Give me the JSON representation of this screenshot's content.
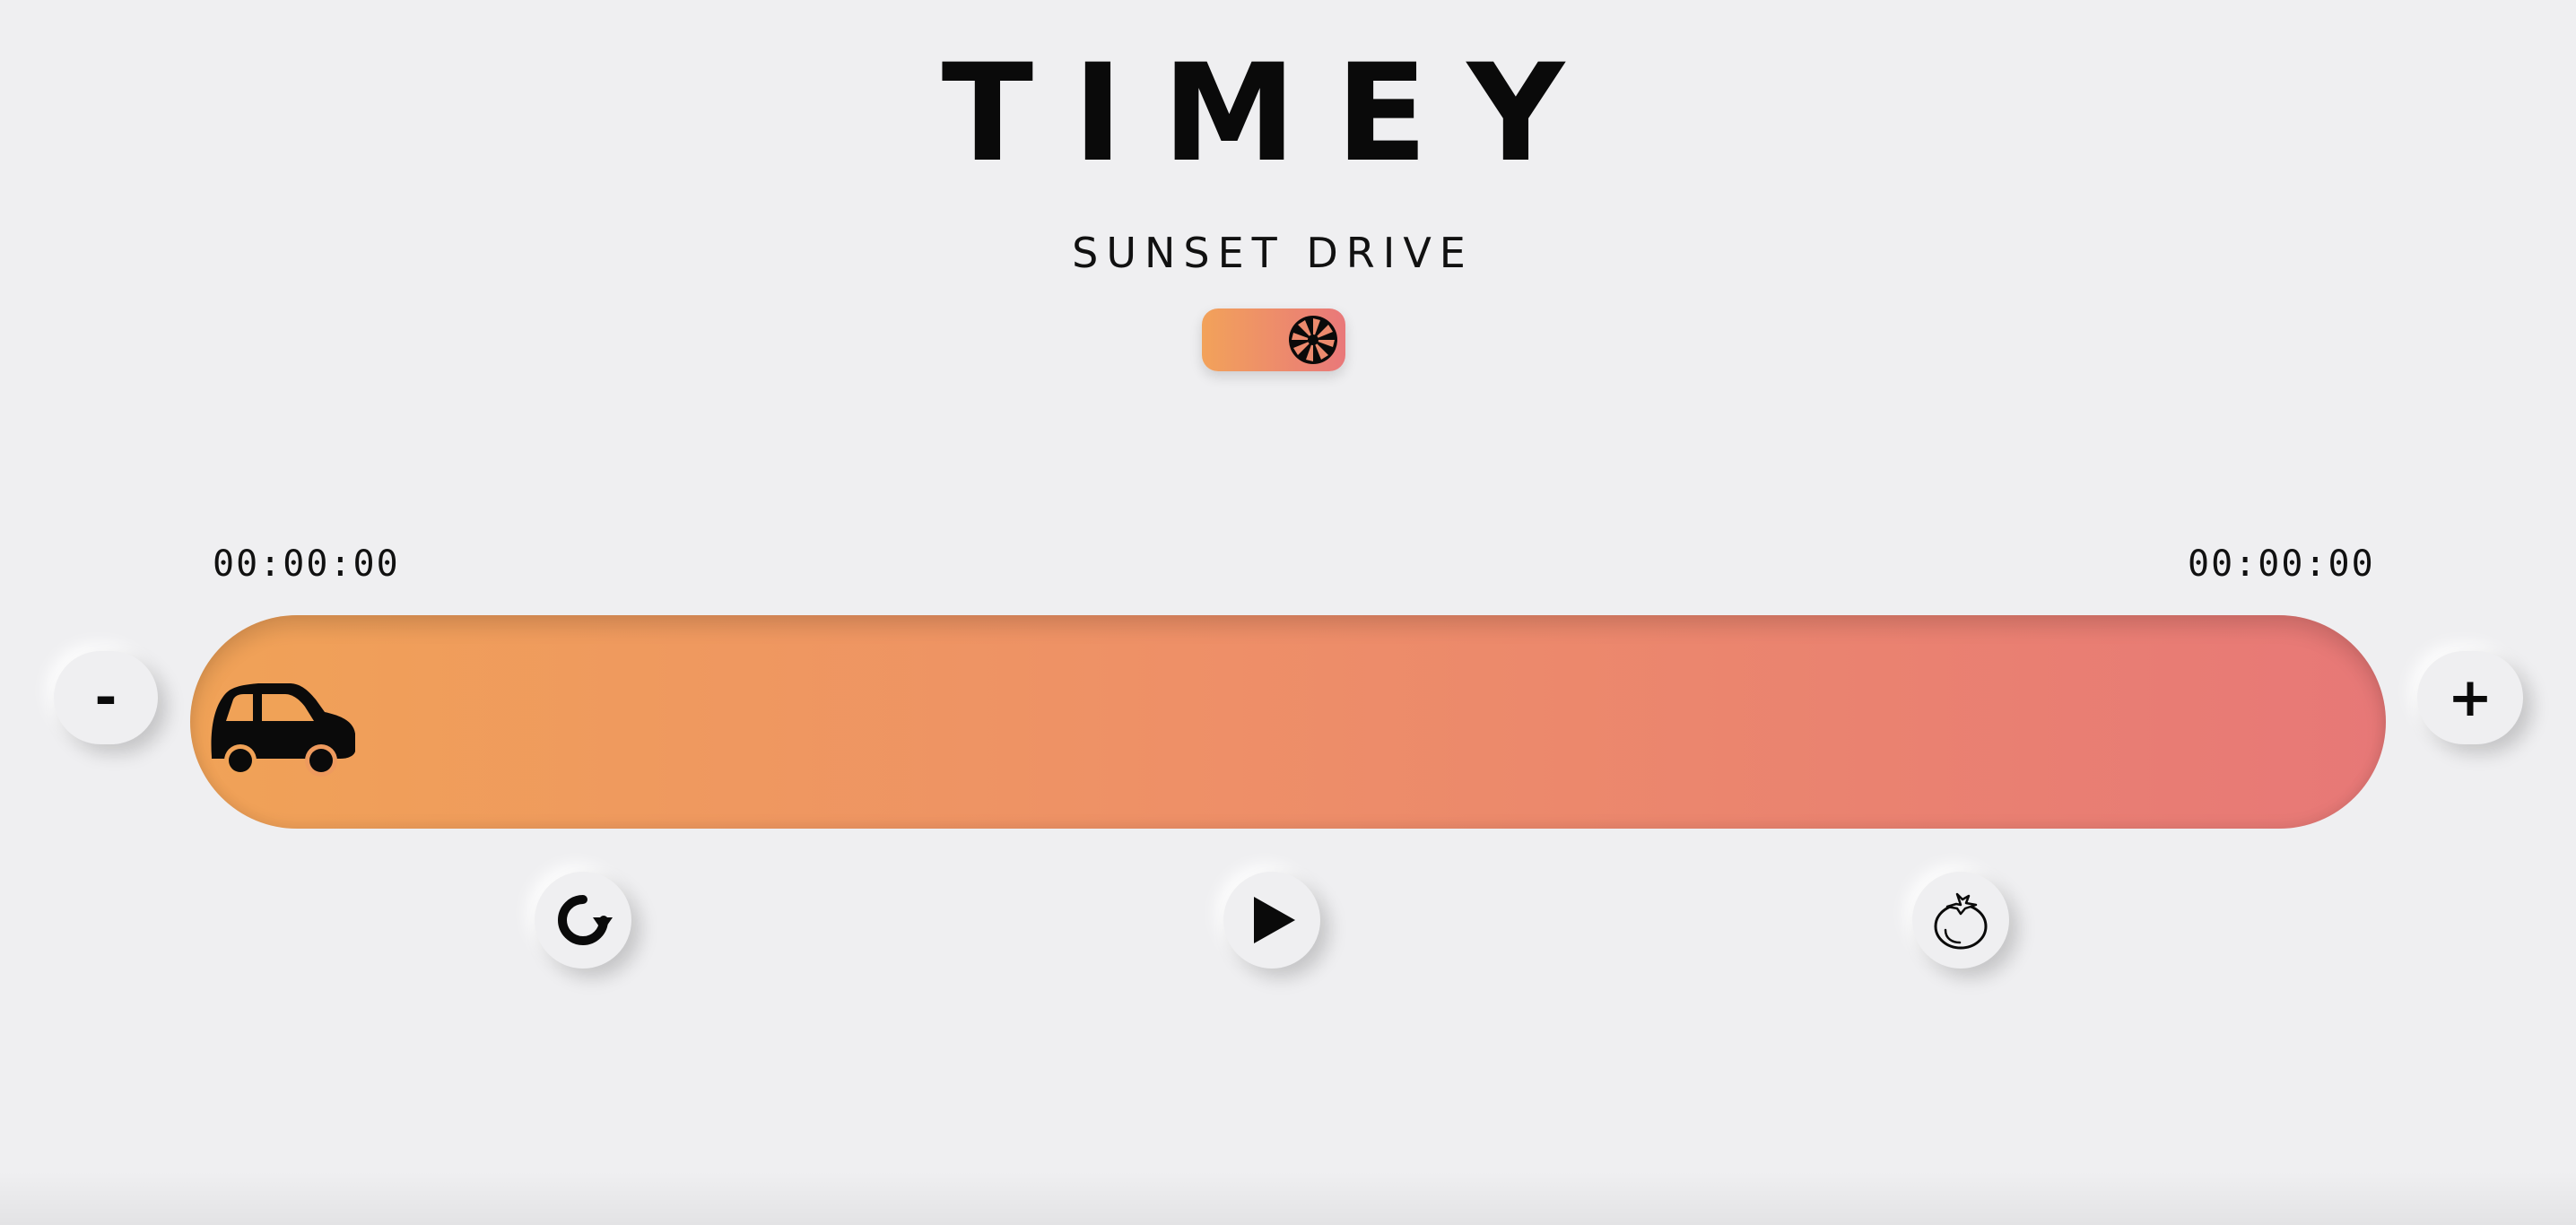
{
  "app": {
    "title": "TIMEY",
    "theme_name": "SUNSET DRIVE"
  },
  "theme_toggle": {
    "icon": "aperture-icon",
    "colors": [
      "#f2a25a",
      "#e9787a"
    ]
  },
  "timer": {
    "elapsed": "00:00:00",
    "target": "00:00:00",
    "progress": 0.0,
    "marker_icon": "car-icon",
    "track_colors": [
      "#f0a257",
      "#e77877"
    ]
  },
  "controls": {
    "decrease_label": "-",
    "increase_label": "+",
    "reset_icon": "reset-icon",
    "play_icon": "play-icon",
    "pomodoro_icon": "tomato-icon"
  }
}
